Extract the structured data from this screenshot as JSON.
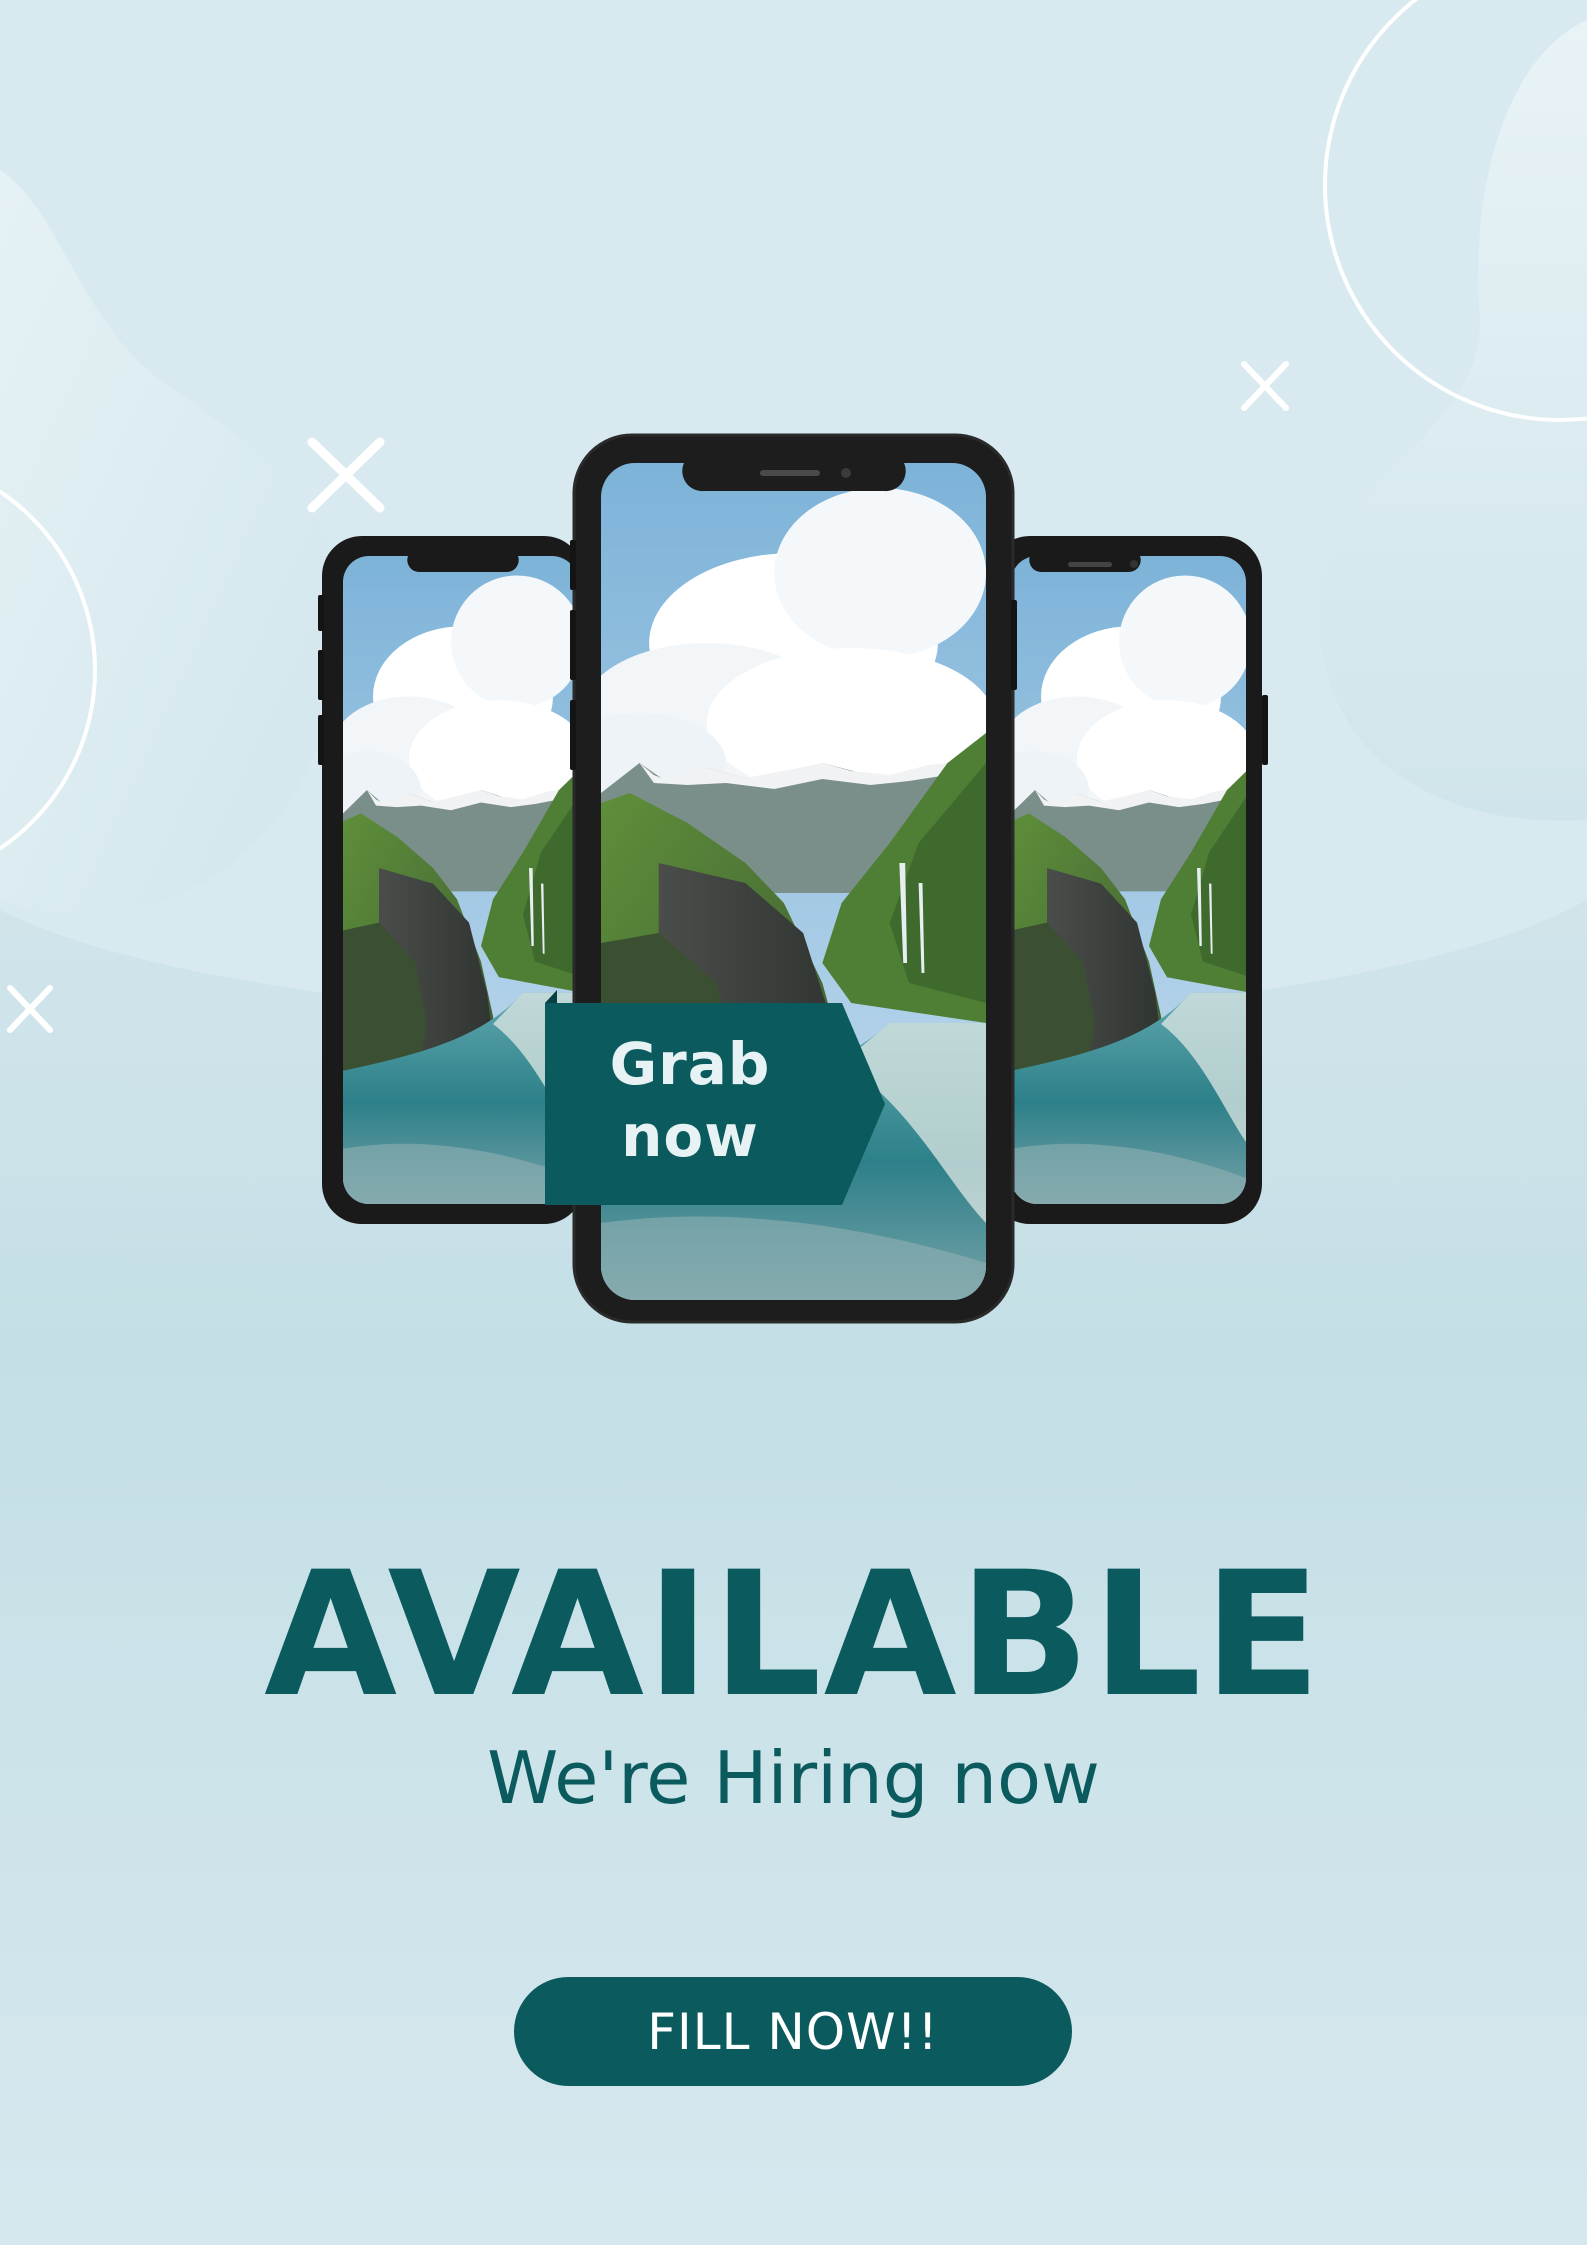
{
  "promo": {
    "ribbon_label": "Grab\nnow",
    "headline": "AVAILABLE",
    "subheadline": "We're Hiring now",
    "cta_label": "FILL NOW!!"
  },
  "icons": [
    "close-x-icon",
    "close-x-icon",
    "close-x-icon"
  ],
  "colors": {
    "accent": "#0b5a5e",
    "background": "#d5e8ee",
    "ribbon_text": "#e6f2f3"
  }
}
